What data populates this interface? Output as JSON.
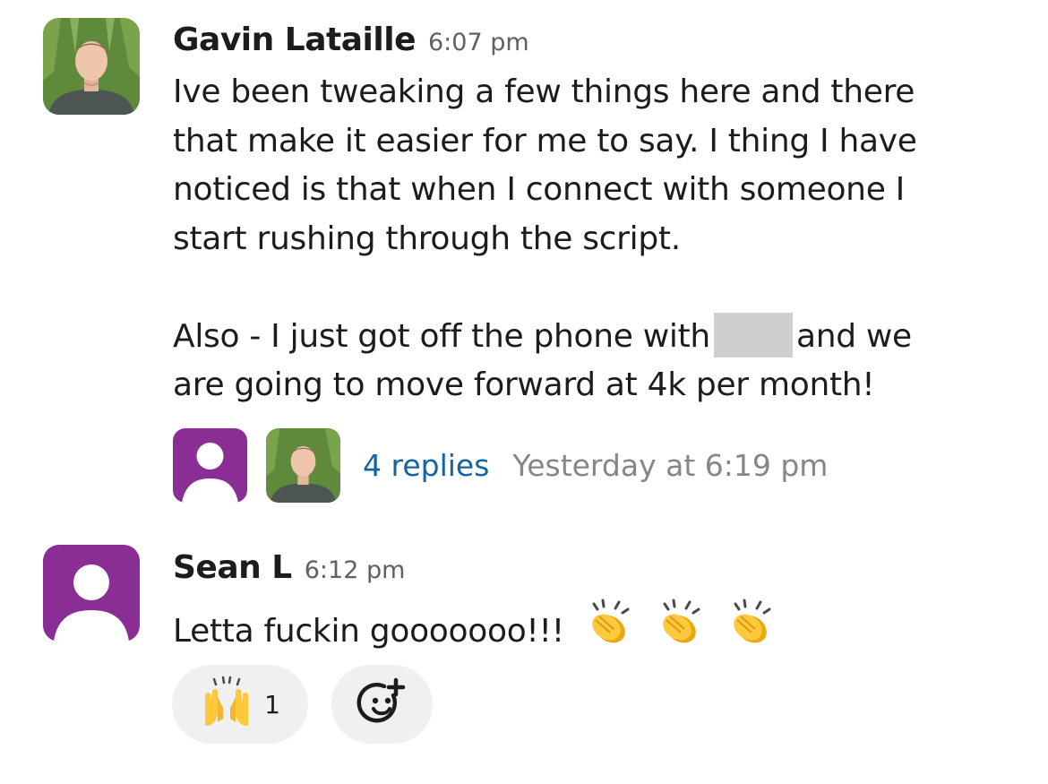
{
  "messages": [
    {
      "author": "Gavin Lataille",
      "time": "6:07 pm",
      "avatar": "person-photo-avatar",
      "lines": [
        "Ive been tweaking a few things here and there",
        "that make it easier for me to say. I thing I have",
        "noticed is that when I connect with someone I",
        "start rushing through the script."
      ],
      "line2_before": "Also - I just got off the phone with",
      "line2_after": "and we",
      "line3": "are going to move forward at 4k per month!",
      "thread": {
        "replies": "4 replies",
        "last_reply": "Yesterday at 6:19 pm"
      }
    },
    {
      "author": "Sean L",
      "time": "6:12 pm",
      "avatar": "default-user-avatar",
      "text": "Letta fuckin gooooooo!!!",
      "inline_emoji": [
        "clap-emoji",
        "clap-emoji",
        "clap-emoji"
      ],
      "reactions": [
        {
          "emoji": "raised-hands-emoji",
          "count": "1"
        }
      ],
      "add_reaction_icon": "add-reaction-icon"
    }
  ],
  "colors": {
    "author": "#1d1c1d",
    "timestamp": "#616061",
    "link": "#1264a3",
    "muted": "#868686",
    "default_avatar": "#8a2e96",
    "reaction_bg": "#f0f0f0"
  }
}
